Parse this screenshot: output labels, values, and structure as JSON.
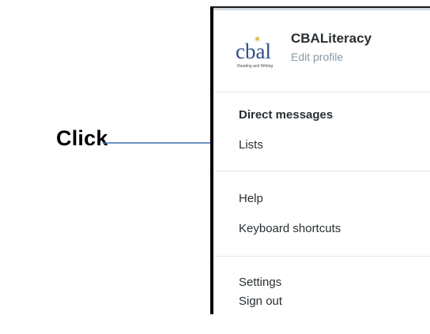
{
  "annotation": {
    "label": "Click"
  },
  "profile": {
    "logo_text": "cbal",
    "logo_subtext": "Reading and Writing",
    "name": "CBALiteracy",
    "edit_label": "Edit profile"
  },
  "menu": {
    "direct_messages": "Direct messages",
    "lists": "Lists",
    "help": "Help",
    "keyboard_shortcuts": "Keyboard shortcuts",
    "settings": "Settings",
    "sign_out": "Sign out"
  },
  "colors": {
    "arrow": "#3b6db3",
    "menu_text": "#292f33",
    "muted_text": "#8899a6",
    "divider": "#e1e8ed"
  }
}
